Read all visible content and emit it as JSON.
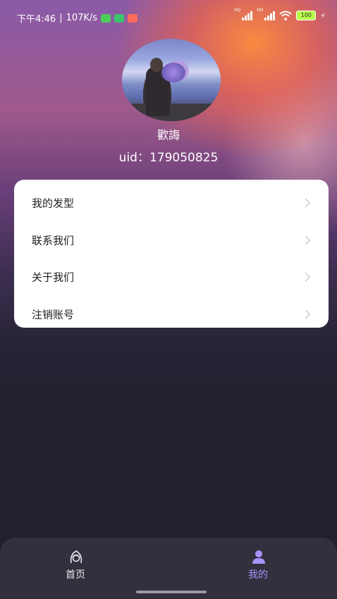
{
  "status_bar": {
    "time": "下午4:46",
    "speed": "107K/s",
    "signal_label": "HD",
    "battery": "100"
  },
  "profile": {
    "username": "歡誨",
    "uid": "uid：179050825"
  },
  "menu": {
    "items": [
      {
        "label": "我的发型"
      },
      {
        "label": "联系我们"
      },
      {
        "label": "关于我们"
      },
      {
        "label": "注销账号"
      }
    ]
  },
  "tabbar": {
    "home_label": "首页",
    "mine_label": "我的",
    "active_color": "#a993ff"
  },
  "colors": {
    "accent": "#a993ff",
    "card": "#ffffff",
    "background": "#21202d"
  }
}
